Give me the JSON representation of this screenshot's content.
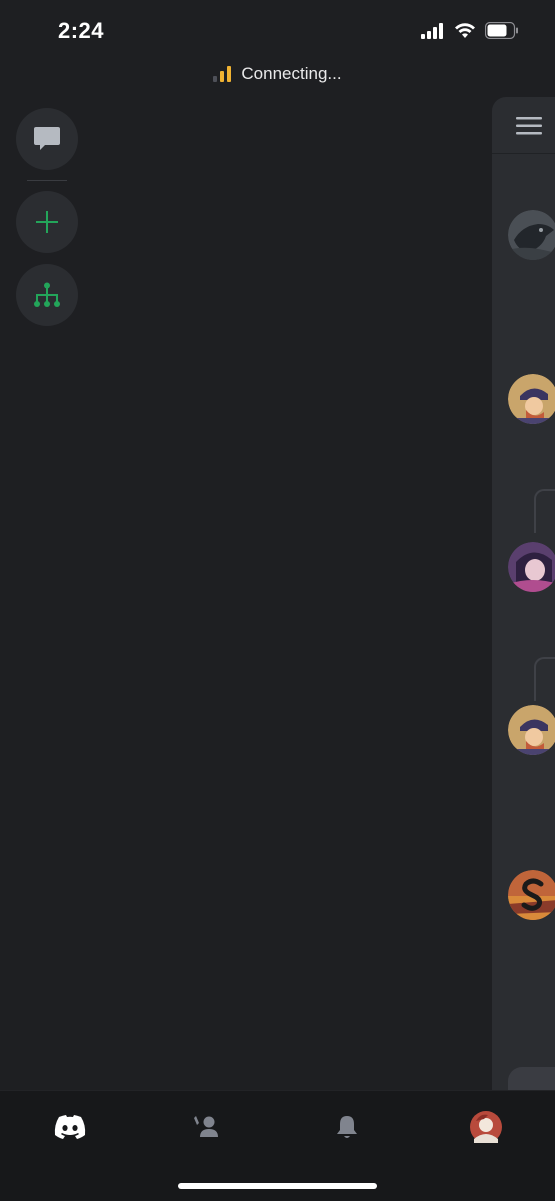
{
  "status_bar": {
    "time": "2:24",
    "signal_icon": "cellular-signal-icon",
    "wifi_icon": "wifi-icon",
    "battery_icon": "battery-icon",
    "battery_level": 0.7
  },
  "connection": {
    "text": "Connecting...",
    "icon": "connection-strength-icon",
    "accent_color": "#f0b232"
  },
  "guild_rail": {
    "items": [
      {
        "name": "direct-messages",
        "icon": "chat-bubble-icon"
      },
      {
        "name": "add-server",
        "icon": "plus-icon",
        "color": "#23a55a"
      },
      {
        "name": "discover-servers",
        "icon": "hierarchy-icon",
        "color": "#23a55a"
      }
    ]
  },
  "dm_panel": {
    "header_icon": "menu-icon",
    "avatars": [
      "avatar-crow",
      "avatar-hat-character",
      "avatar-purple-hair",
      "avatar-hat-character-2",
      "avatar-s-logo"
    ]
  },
  "bottom_nav": {
    "items": [
      {
        "name": "home",
        "icon": "discord-icon",
        "active": true
      },
      {
        "name": "friends",
        "icon": "friends-wave-icon",
        "active": false
      },
      {
        "name": "notifications",
        "icon": "bell-icon",
        "active": false
      },
      {
        "name": "profile",
        "icon": "user-avatar",
        "active": false
      }
    ]
  },
  "colors": {
    "background": "#1e1f22",
    "panel": "#2b2d31",
    "nav": "#17181a",
    "green": "#23a55a",
    "connecting_bars": "#f0b232"
  }
}
